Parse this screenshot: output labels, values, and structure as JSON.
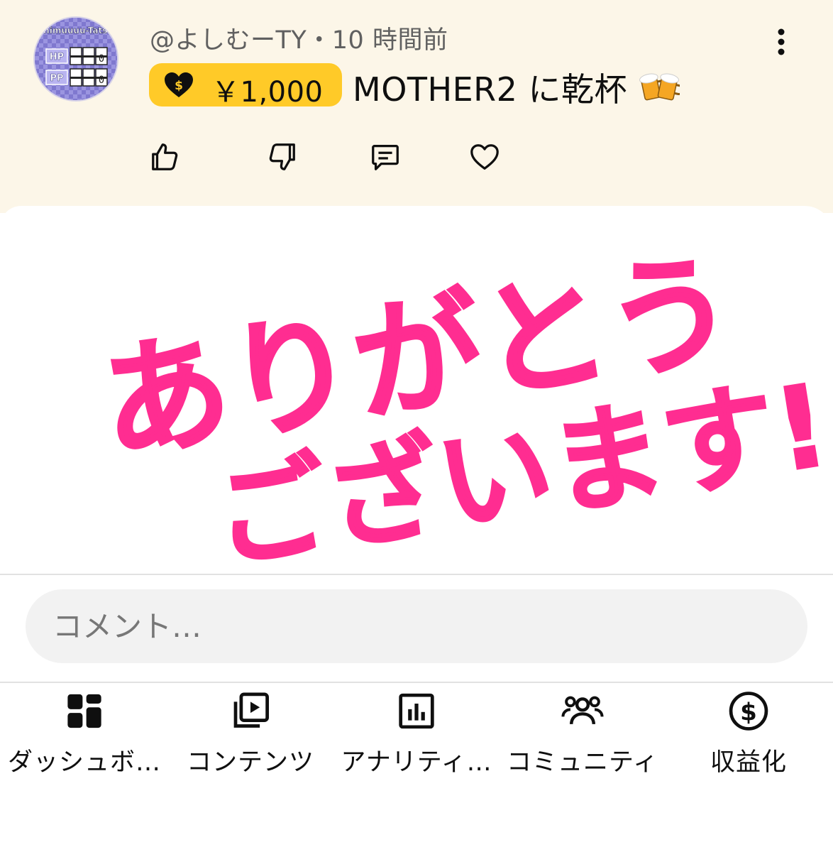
{
  "comment": {
    "author": "@よしむーTY",
    "separator": "・",
    "time": "10 時間前",
    "avatar": {
      "name_text": "Yoshimuuuu-Tatsuya",
      "stat_labels": [
        "HP",
        "PP"
      ],
      "stat_values": [
        "0",
        "0"
      ]
    },
    "superthanks": {
      "amount": "￥1,000",
      "icon": "heart-dollar-icon",
      "color": "#ffca28"
    },
    "text": "MOTHER2 に乾杯",
    "emoji_icon": "beer-mugs-icon",
    "actions": [
      {
        "name": "like",
        "icon": "thumbs-up-icon"
      },
      {
        "name": "dislike",
        "icon": "thumbs-down-icon"
      },
      {
        "name": "reply",
        "icon": "comment-icon"
      },
      {
        "name": "heart",
        "icon": "heart-outline-icon"
      }
    ],
    "background": "#fcf6e8"
  },
  "image": {
    "line1": "ありがとう",
    "line2": "ございます!!",
    "ink_color": "#ff2d91"
  },
  "comment_box": {
    "placeholder": "コメント…"
  },
  "bottom_nav": [
    {
      "label": "ダッシュボ…",
      "icon": "dashboard-icon"
    },
    {
      "label": "コンテンツ",
      "icon": "content-icon"
    },
    {
      "label": "アナリティ…",
      "icon": "analytics-icon"
    },
    {
      "label": "コミュニティ",
      "icon": "community-icon"
    },
    {
      "label": "収益化",
      "icon": "monetization-icon"
    }
  ]
}
